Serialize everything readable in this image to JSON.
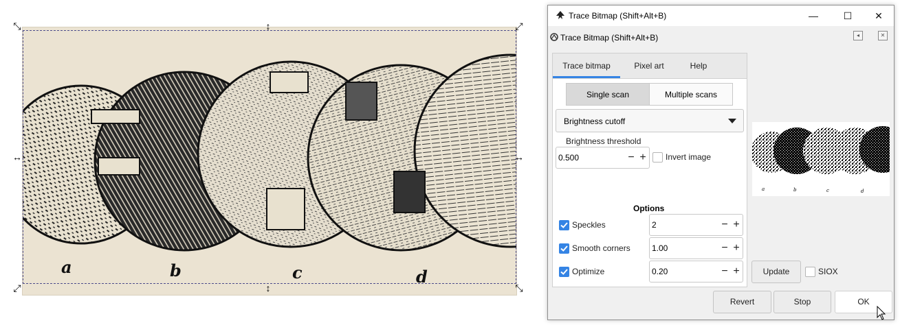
{
  "canvas": {
    "figure_labels": [
      "a",
      "b",
      "c",
      "d"
    ]
  },
  "dialog": {
    "title": "Trace Bitmap (Shift+Alt+B)",
    "panel_title": "Trace Bitmap (Shift+Alt+B)",
    "window_buttons": {
      "minimize": "—",
      "maximize": "☐",
      "close": "✕"
    },
    "tabs": [
      {
        "label": "Trace bitmap",
        "active": true
      },
      {
        "label": "Pixel art",
        "active": false
      },
      {
        "label": "Help",
        "active": false
      }
    ],
    "scan_modes": [
      {
        "label": "Single scan",
        "active": true
      },
      {
        "label": "Multiple scans",
        "active": false
      }
    ],
    "detection_mode": "Brightness cutoff",
    "threshold": {
      "label": "Brightness threshold",
      "value": "0.500"
    },
    "invert_image": {
      "label": "Invert image",
      "checked": false
    },
    "options_title": "Options",
    "options": [
      {
        "label": "Speckles",
        "checked": true,
        "value": "2"
      },
      {
        "label": "Smooth corners",
        "checked": true,
        "value": "1.00"
      },
      {
        "label": "Optimize",
        "checked": true,
        "value": "0.20"
      }
    ],
    "update_button": "Update",
    "siox": {
      "label": "SIOX",
      "checked": false
    },
    "buttons": {
      "revert": "Revert",
      "stop": "Stop",
      "ok": "OK"
    },
    "accent_color": "#3584e4"
  }
}
